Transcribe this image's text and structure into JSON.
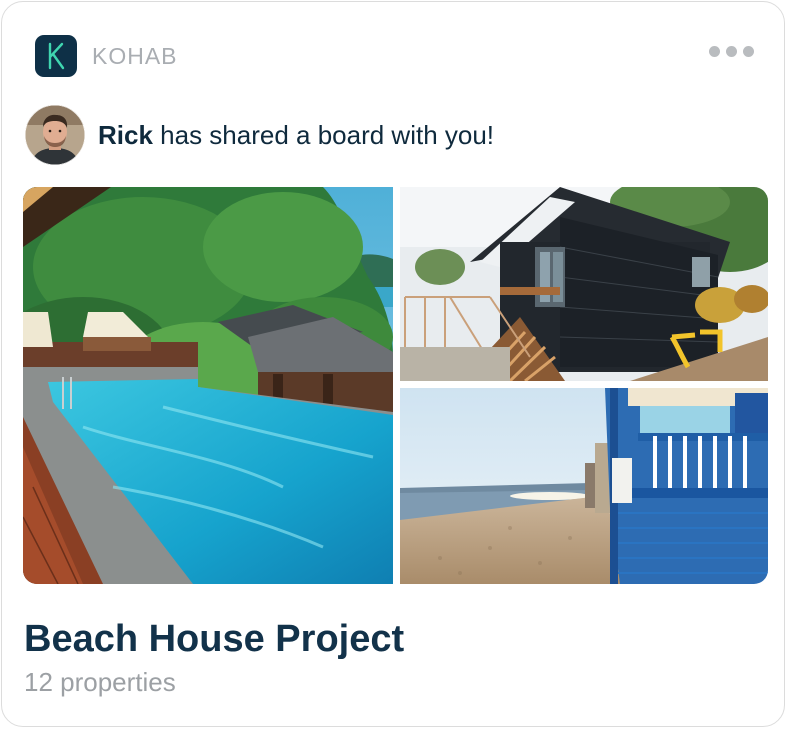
{
  "app": {
    "name": "KOHAB",
    "icon": "kohab-logo-icon",
    "icon_letter": "K",
    "menu_icon": "more-horizontal-icon"
  },
  "notification": {
    "sender": "Rick",
    "message": " has shared a board with you!"
  },
  "board": {
    "photos": [
      {
        "subject": "infinity pool with lounge chairs and tropical trees"
      },
      {
        "subject": "dark timber house with deck stairs and yellow chairs"
      },
      {
        "subject": "sandy beach with blue beach huts"
      }
    ],
    "title": "Beach House Project",
    "subtitle": "12 properties"
  },
  "colors": {
    "primary_text": "#12324a",
    "muted_text": "#9ca0a4",
    "icon_bg": "#0e3047",
    "icon_fg": "#3fd6b0"
  }
}
